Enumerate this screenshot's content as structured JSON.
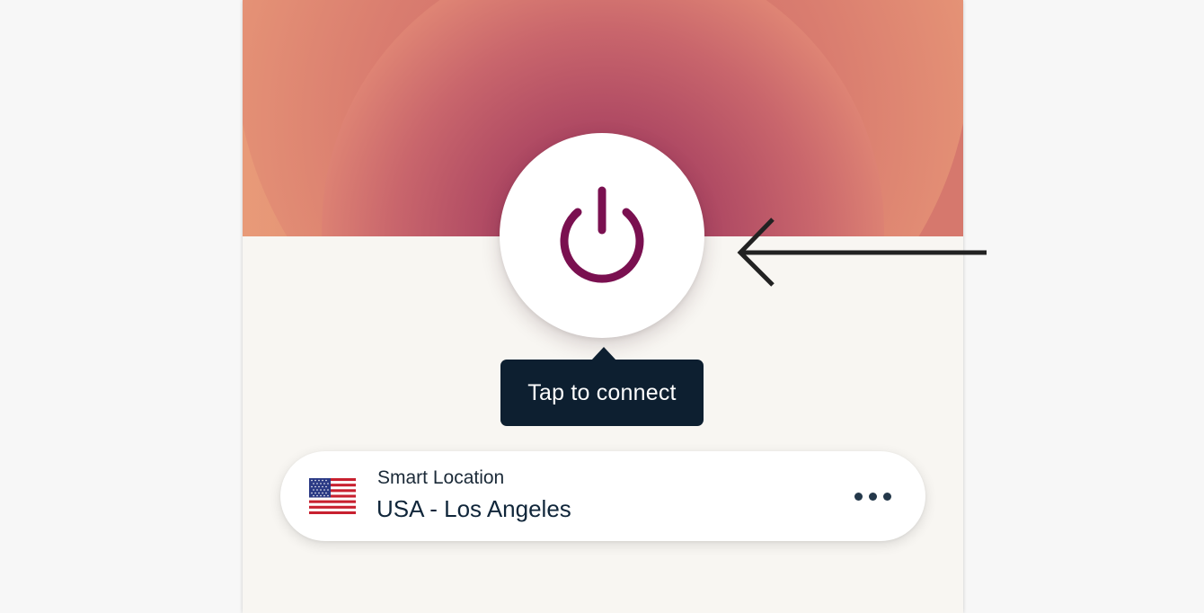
{
  "power": {
    "icon": "power-icon",
    "color": "#7a1050"
  },
  "tooltip": {
    "text": "Tap to connect"
  },
  "location": {
    "label": "Smart Location",
    "name": "USA - Los Angeles",
    "flag_icon": "us-flag-icon",
    "more_icon": "more-dots-icon"
  },
  "annotation": {
    "icon": "arrow-left-icon"
  },
  "colors": {
    "accent": "#7a1050",
    "tooltip_bg": "#0d1f30",
    "panel_bg": "#f8f6f2",
    "hero_warm": "#e99a78"
  }
}
